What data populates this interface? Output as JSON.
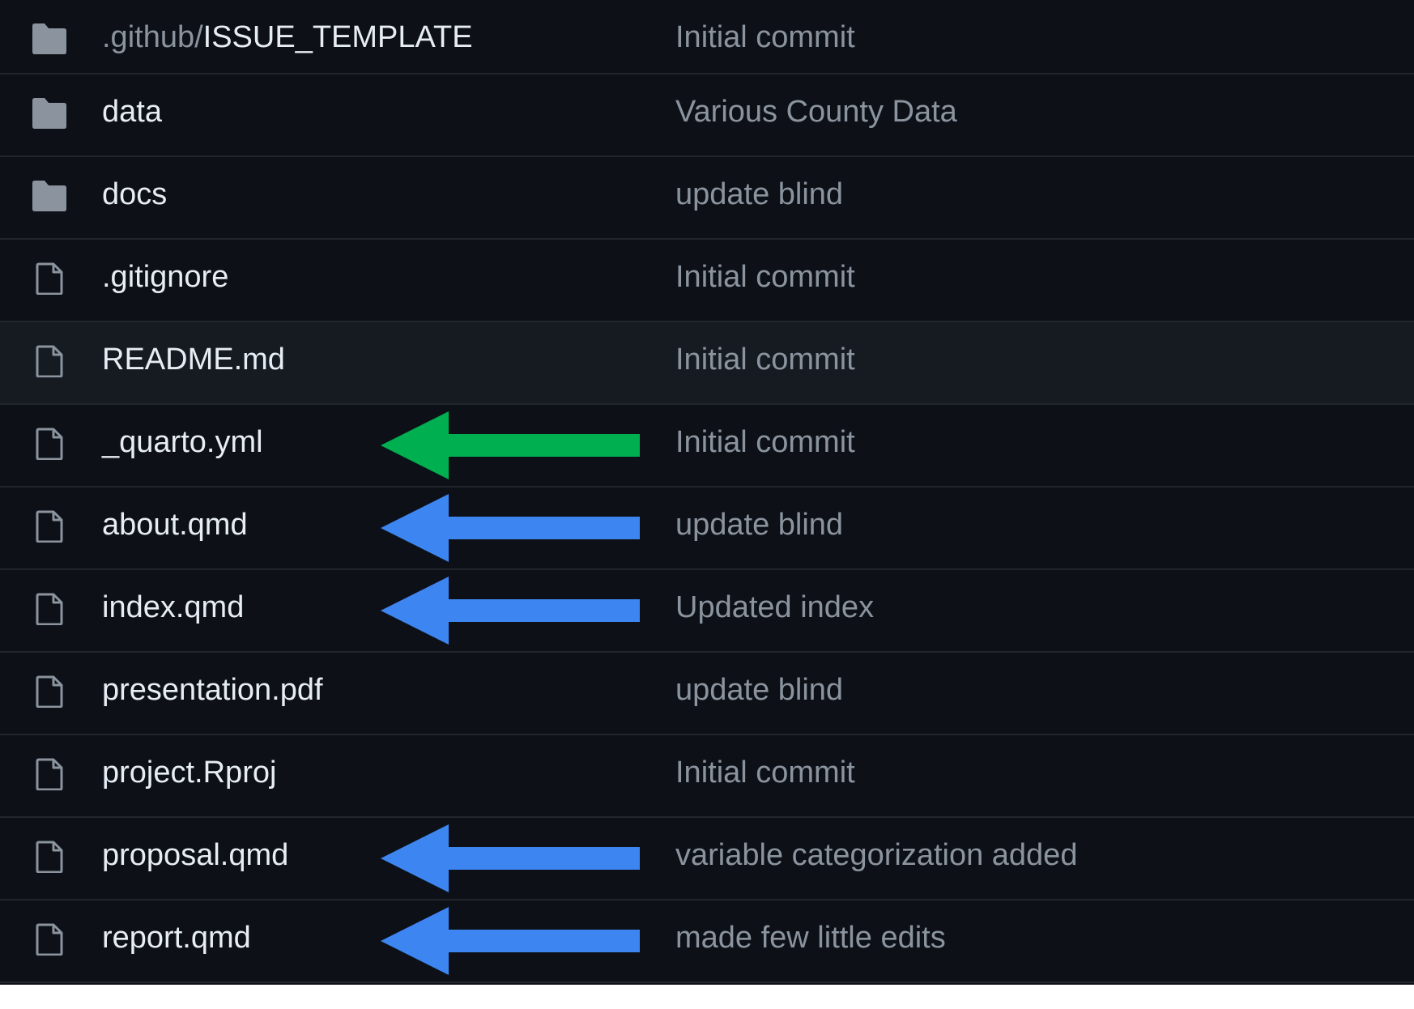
{
  "colors": {
    "background": "#0d1117",
    "row_highlight": "#161b22",
    "divider": "#21262d",
    "file_name": "#e6edf3",
    "muted_text": "#8b949e",
    "icon": "#8b949e",
    "arrow_green": "#00b050",
    "arrow_blue": "#3d85f0"
  },
  "files": [
    {
      "type": "folder",
      "icon": "folder-icon",
      "prefix": ".github/",
      "name": "ISSUE_TEMPLATE",
      "message": "Initial commit",
      "annotation": null
    },
    {
      "type": "folder",
      "icon": "folder-icon",
      "prefix": "",
      "name": "data",
      "message": "Various County Data",
      "annotation": null
    },
    {
      "type": "folder",
      "icon": "folder-icon",
      "prefix": "",
      "name": "docs",
      "message": "update blind",
      "annotation": null
    },
    {
      "type": "file",
      "icon": "file-icon",
      "prefix": "",
      "name": ".gitignore",
      "message": "Initial commit",
      "annotation": null
    },
    {
      "type": "file",
      "icon": "file-icon",
      "prefix": "",
      "name": "README.md",
      "message": "Initial commit",
      "annotation": null,
      "highlighted": true
    },
    {
      "type": "file",
      "icon": "file-icon",
      "prefix": "",
      "name": "_quarto.yml",
      "message": "Initial commit",
      "annotation": "green-arrow-icon"
    },
    {
      "type": "file",
      "icon": "file-icon",
      "prefix": "",
      "name": "about.qmd",
      "message": "update blind",
      "annotation": "blue-arrow-icon"
    },
    {
      "type": "file",
      "icon": "file-icon",
      "prefix": "",
      "name": "index.qmd",
      "message": "Updated index",
      "annotation": "blue-arrow-icon"
    },
    {
      "type": "file",
      "icon": "file-icon",
      "prefix": "",
      "name": "presentation.pdf",
      "message": "update blind",
      "annotation": null
    },
    {
      "type": "file",
      "icon": "file-icon",
      "prefix": "",
      "name": "project.Rproj",
      "message": "Initial commit",
      "annotation": null
    },
    {
      "type": "file",
      "icon": "file-icon",
      "prefix": "",
      "name": "proposal.qmd",
      "message": "variable categorization added",
      "annotation": "blue-arrow-icon"
    },
    {
      "type": "file",
      "icon": "file-icon",
      "prefix": "",
      "name": "report.qmd",
      "message": "made few little edits",
      "annotation": "blue-arrow-icon"
    }
  ]
}
